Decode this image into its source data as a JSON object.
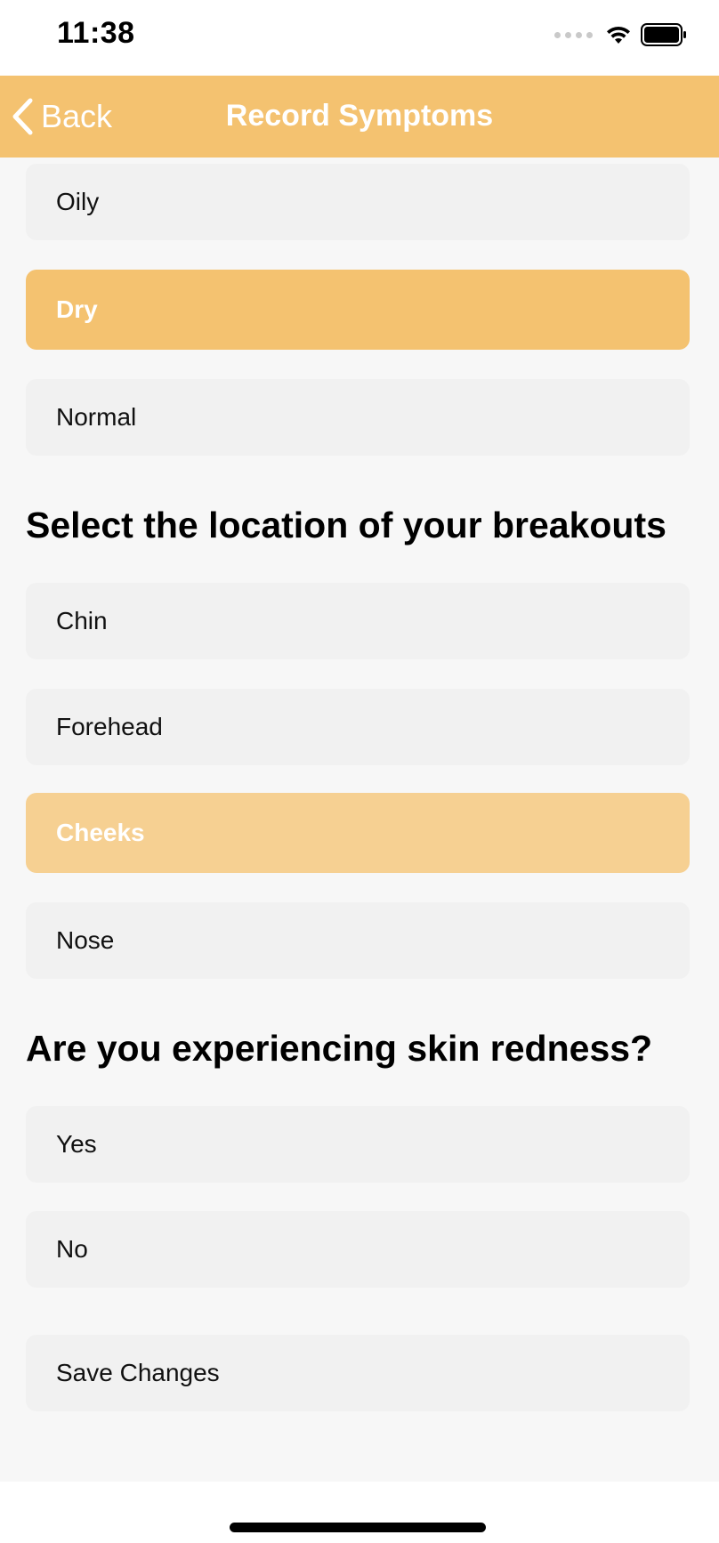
{
  "status_bar": {
    "time": "11:38",
    "icons": [
      "signal-dots-icon",
      "wifi-icon",
      "battery-icon"
    ]
  },
  "nav": {
    "back_label": "Back",
    "title": "Record Symptoms"
  },
  "skin_type": {
    "options": [
      {
        "label": "Oily",
        "selected": false
      },
      {
        "label": "Dry",
        "selected": true
      },
      {
        "label": "Normal",
        "selected": false
      }
    ]
  },
  "breakouts": {
    "title": "Select the location of your breakouts",
    "options": [
      {
        "label": "Chin",
        "selected": false
      },
      {
        "label": "Forehead",
        "selected": false
      },
      {
        "label": "Cheeks",
        "selected": true
      },
      {
        "label": "Nose",
        "selected": false
      }
    ]
  },
  "redness": {
    "title": "Are you experiencing skin redness?",
    "options": [
      {
        "label": "Yes",
        "selected": false
      },
      {
        "label": "No",
        "selected": false
      }
    ]
  },
  "save_label": "Save Changes",
  "colors": {
    "accent": "#f4c270",
    "accent_light": "#f6d092",
    "option_bg": "#f1f1f1",
    "page_bg": "#f7f7f7"
  }
}
